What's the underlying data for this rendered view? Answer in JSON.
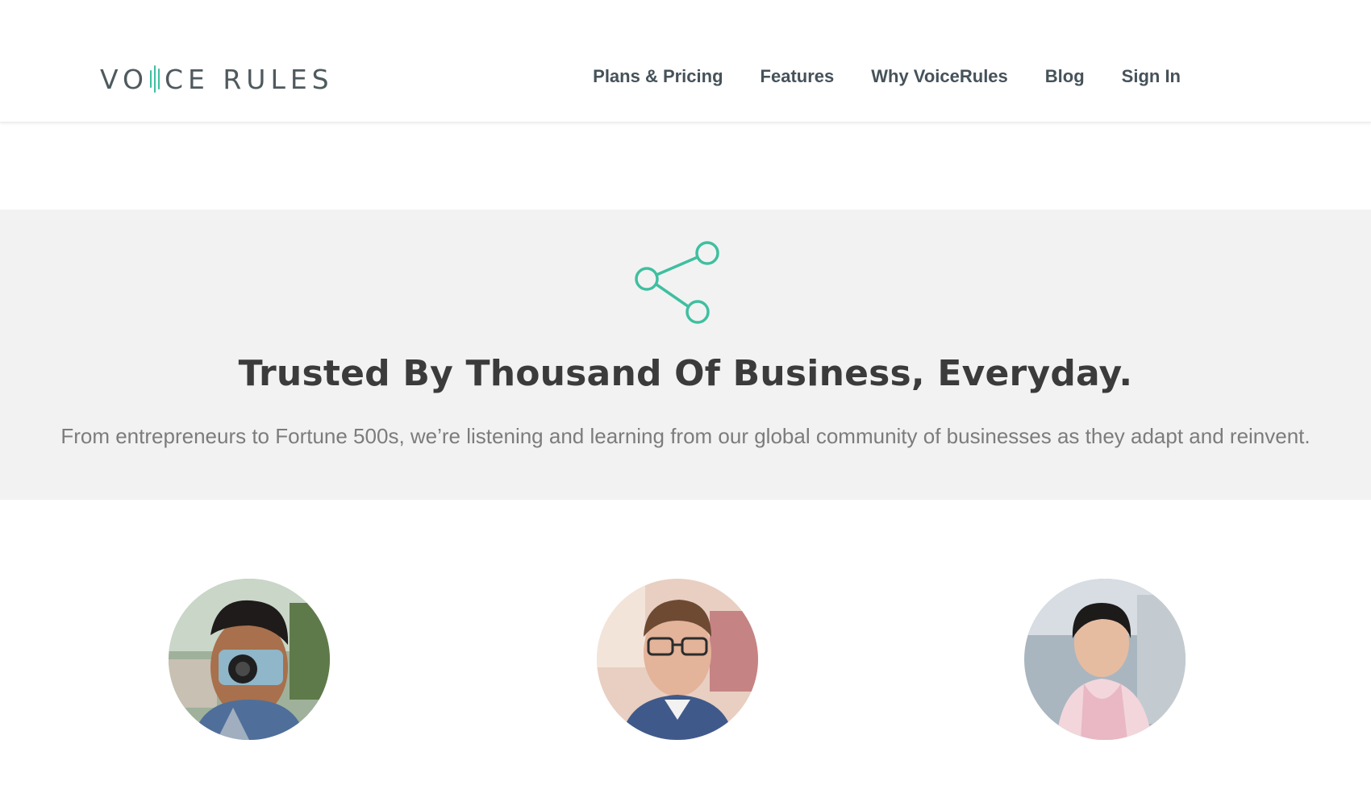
{
  "brand": {
    "logo_left": "VO",
    "logo_right": "CE RULES",
    "accent_color": "#3fbfa0"
  },
  "nav": {
    "items": [
      {
        "label": "Plans & Pricing"
      },
      {
        "label": "Features"
      },
      {
        "label": "Why VoiceRules"
      },
      {
        "label": "Blog"
      },
      {
        "label": "Sign In"
      }
    ]
  },
  "trust": {
    "icon": "share-icon",
    "title": "Trusted By Thousand Of Business, Everyday.",
    "subtitle": "From entrepreneurs to Fortune 500s, we’re listening and learning from our global community of businesses as they adapt and reinvent."
  },
  "testimonials": {
    "avatars": [
      {
        "icon": "avatar-photographer"
      },
      {
        "icon": "avatar-man-glasses"
      },
      {
        "icon": "avatar-woman"
      }
    ]
  }
}
